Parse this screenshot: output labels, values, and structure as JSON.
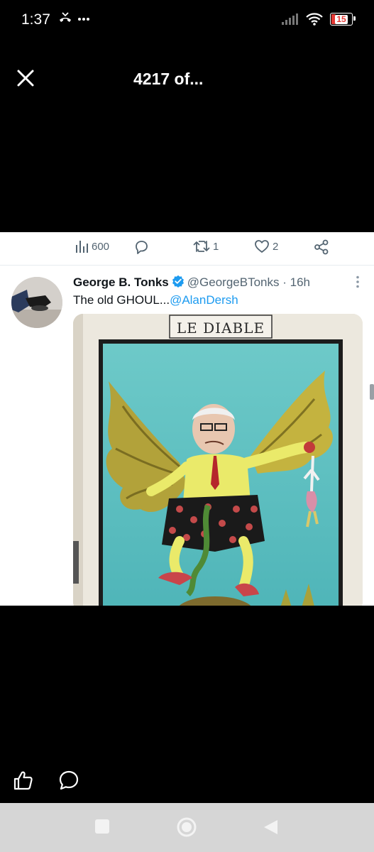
{
  "status": {
    "time": "1:37",
    "left_icons": "missed-call-icon, more-dots-icon",
    "battery": "15",
    "battery_color": "#e53935"
  },
  "viewer": {
    "title": "4217 of..."
  },
  "actions": {
    "views": "600",
    "retweets": "1",
    "likes": "2"
  },
  "tweet": {
    "author": "George B. Tonks",
    "handle": "@GeorgeBTonks",
    "separator": "·",
    "time": "16h",
    "text": "The old GHOUL...",
    "mention": "@AlanDersh",
    "image_caption": "LE DIABLE",
    "verified_color": "#1d9bf0"
  },
  "colors": {
    "link": "#1d9bf0",
    "secondary_text": "#536471",
    "nav_bar": "#d6d6d6"
  }
}
